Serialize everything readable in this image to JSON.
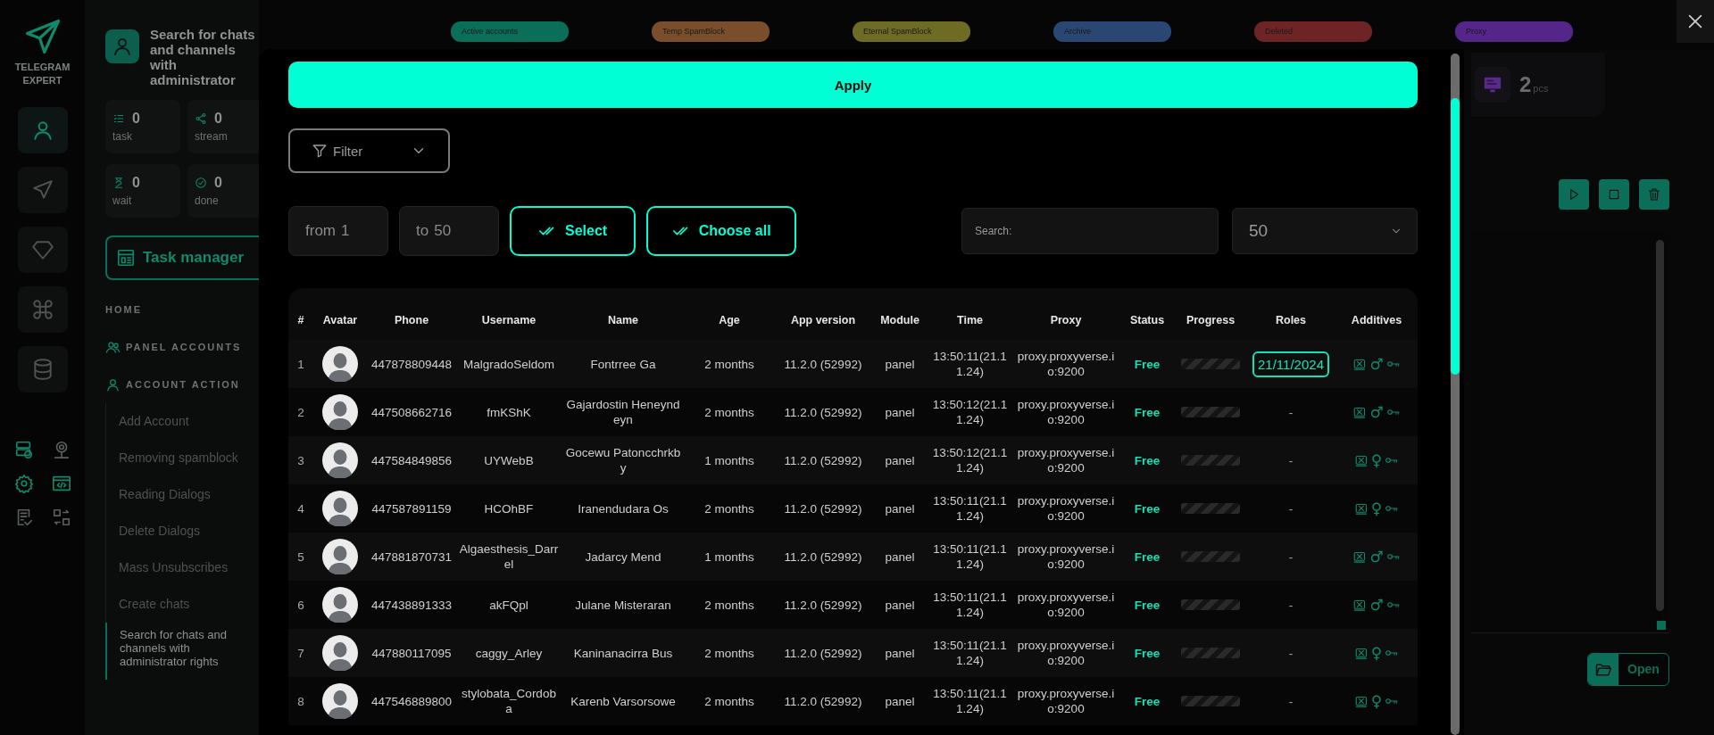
{
  "rail": {
    "logo": "TELEGRAM EXPERT",
    "items": [
      {
        "selected": true
      },
      {
        "selected": false
      },
      {
        "selected": false
      },
      {
        "selected": false
      },
      {
        "selected": false
      }
    ]
  },
  "panel": {
    "title": "Search for chats and channels with administrator",
    "stats": [
      {
        "value": "0",
        "label": "task"
      },
      {
        "value": "0",
        "label": "stream"
      },
      {
        "value": "0",
        "label": "wait"
      },
      {
        "value": "0",
        "label": "done"
      }
    ],
    "task_manager": "Task manager",
    "nav": [
      {
        "label": "HOME",
        "kind": "plain"
      },
      {
        "label": "PANEL ACCOUNTS",
        "kind": "group"
      },
      {
        "label": "ACCOUNT ACTION",
        "kind": "person",
        "children": [
          {
            "label": "Add Account",
            "selected": false
          },
          {
            "label": "Removing spamblock",
            "selected": false
          },
          {
            "label": "Reading Dialogs",
            "selected": false
          },
          {
            "label": "Delete Dialogs",
            "selected": false
          },
          {
            "label": "Mass Unsubscribes",
            "selected": false
          },
          {
            "label": "Create chats",
            "selected": false
          },
          {
            "label": "Search for chats and channels with administrator rights",
            "selected": true
          }
        ]
      }
    ]
  },
  "status_tabs": [
    {
      "label": "Active accounts",
      "color": "#0b6e58"
    },
    {
      "label": "Temp SpamBlock",
      "color": "#7a4e2a"
    },
    {
      "label": "Eternal SpamBlock",
      "color": "#6e6c24"
    },
    {
      "label": "Archive",
      "color": "#2a4672"
    },
    {
      "label": "Deleted",
      "color": "#6e2424"
    },
    {
      "label": "Proxy",
      "color": "#55258a"
    }
  ],
  "modal": {
    "apply": "Apply",
    "filter": "Filter",
    "from": {
      "label": "from",
      "value": "1"
    },
    "to": {
      "label": "to",
      "value": "50"
    },
    "select": "Select",
    "choose_all": "Choose all",
    "search": {
      "placeholder": "Search:"
    },
    "page_size": "50",
    "table": {
      "columns": [
        "#",
        "Avatar",
        "Phone",
        "Username",
        "Name",
        "Age",
        "App version",
        "Module",
        "Time",
        "Proxy",
        "Status",
        "Progress",
        "Roles",
        "Additives"
      ],
      "rows": [
        {
          "num": "1",
          "phone": "447878809448",
          "username": "MalgradoSeldom",
          "name": "Fontrree Ga",
          "age": "2 months",
          "app_version": "11.2.0 (52992)",
          "module": "panel",
          "time": "13:50:11(21.11.24)",
          "proxy": "proxy.proxyverse.io:9200",
          "status": "Free",
          "role": "21/11/2024",
          "gender": "♂",
          "progress": {
            "level": 0
          }
        },
        {
          "num": "2",
          "phone": "447508662716",
          "username": "fmKShK",
          "name": "Gajardostin Heneyndeyn",
          "age": "2 months",
          "app_version": "11.2.0 (52992)",
          "module": "panel",
          "time": "13:50:12(21.11.24)",
          "proxy": "proxy.proxyverse.io:9200",
          "status": "Free",
          "role": "-",
          "gender": "♂",
          "progress": {
            "level": 0
          }
        },
        {
          "num": "3",
          "phone": "447584849856",
          "username": "UYWebB",
          "name": "Gocewu Patoncchrkby",
          "age": "1 months",
          "app_version": "11.2.0 (52992)",
          "module": "panel",
          "time": "13:50:12(21.11.24)",
          "proxy": "proxy.proxyverse.io:9200",
          "status": "Free",
          "role": "-",
          "gender": "♀",
          "progress": {
            "level": 0
          }
        },
        {
          "num": "4",
          "phone": "447587891159",
          "username": "HCOhBF",
          "name": "Iranendudara Os",
          "age": "2 months",
          "app_version": "11.2.0 (52992)",
          "module": "panel",
          "time": "13:50:11(21.11.24)",
          "proxy": "proxy.proxyverse.io:9200",
          "status": "Free",
          "role": "-",
          "gender": "♀",
          "progress": {
            "level": 0
          }
        },
        {
          "num": "5",
          "phone": "447881870731",
          "username": "Algaesthesis_Darrel",
          "name": "Jadarcy Mend",
          "age": "1 months",
          "app_version": "11.2.0 (52992)",
          "module": "panel",
          "time": "13:50:11(21.11.24)",
          "proxy": "proxy.proxyverse.io:9200",
          "status": "Free",
          "role": "-",
          "gender": "♂",
          "progress": {
            "level": 0
          }
        },
        {
          "num": "6",
          "phone": "447438891333",
          "username": "akFQpl",
          "name": "Julane Misteraran",
          "age": "2 months",
          "app_version": "11.2.0 (52992)",
          "module": "panel",
          "time": "13:50:11(21.11.24)",
          "proxy": "proxy.proxyverse.io:9200",
          "status": "Free",
          "role": "-",
          "gender": "♂",
          "progress": {
            "level": 0
          }
        },
        {
          "num": "7",
          "phone": "447880117095",
          "username": "caggy_Arley",
          "name": "Kaninanacirra Bus",
          "age": "2 months",
          "app_version": "11.2.0 (52992)",
          "module": "panel",
          "time": "13:50:11(21.11.24)",
          "proxy": "proxy.proxyverse.io:9200",
          "status": "Free",
          "role": "-",
          "gender": "♀",
          "progress": {
            "level": 0
          }
        },
        {
          "num": "8",
          "phone": "447546889800",
          "username": "stylobata_Cordoba",
          "name": "Karenb Varsorsowe",
          "age": "2 months",
          "app_version": "11.2.0 (52992)",
          "module": "panel",
          "time": "13:50:11(21.11.24)",
          "proxy": "proxy.proxyverse.io:9200",
          "status": "Free",
          "role": "-",
          "gender": "♀",
          "progress": {
            "level": 0
          }
        }
      ]
    }
  },
  "proxy_card": {
    "value": "2",
    "unit": "pcs"
  },
  "open_button": "Open"
}
